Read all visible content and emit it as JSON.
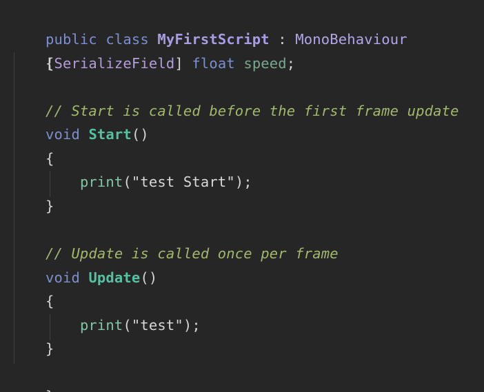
{
  "colors": {
    "background": "#262626",
    "keyword": "#7b8fd1",
    "class_name": "#a99ce6",
    "comment": "#a2b96b",
    "method": "#55c1a3",
    "field": "#7aa88d"
  },
  "code": {
    "l1": {
      "kw_public": "public",
      "kw_class": "class",
      "class_name": "MyFirstScript",
      "colon": ":",
      "base": "MonoBehaviour"
    },
    "l2": {
      "brace": "{"
    },
    "l3": {
      "attr_open": "[",
      "attr": "SerializeField",
      "attr_close": "]",
      "kw_float": "float",
      "field": "speed",
      "semi": ";"
    },
    "l5": {
      "comment": "// Start is called before the first frame update"
    },
    "l6": {
      "kw_void": "void",
      "method": "Start",
      "parens": "()"
    },
    "l7": {
      "brace": "{"
    },
    "l8": {
      "call": "print",
      "open": "(",
      "string": "\"test Start\"",
      "close": ");"
    },
    "l9": {
      "brace": "}"
    },
    "l11": {
      "comment": "// Update is called once per frame"
    },
    "l12": {
      "kw_void": "void",
      "method": "Update",
      "parens": "()"
    },
    "l13": {
      "brace": "{"
    },
    "l14": {
      "call": "print",
      "open": "(",
      "string": "\"test\"",
      "close": ");"
    },
    "l15": {
      "brace": "}"
    },
    "l16": {
      "brace": "}"
    }
  }
}
